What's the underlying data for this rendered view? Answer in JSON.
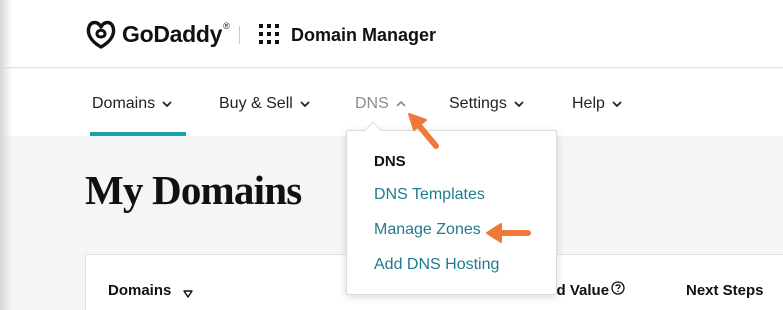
{
  "brand": {
    "logo_text": "GoDaddy",
    "trademark": "®",
    "app_title": "Domain Manager",
    "logo_icon": "godaddy-logo-icon",
    "apps_icon": "grid-apps-icon"
  },
  "nav": {
    "items": [
      {
        "label": "Domains",
        "state": "active"
      },
      {
        "label": "Buy & Sell",
        "state": "normal"
      },
      {
        "label": "DNS",
        "state": "open"
      },
      {
        "label": "Settings",
        "state": "normal"
      },
      {
        "label": "Help",
        "state": "normal"
      }
    ]
  },
  "dns_menu": {
    "header": "DNS",
    "items": [
      {
        "label": "DNS Templates"
      },
      {
        "label": "Manage Zones"
      },
      {
        "label": "Add DNS Hosting"
      }
    ]
  },
  "page": {
    "title": "My Domains"
  },
  "table": {
    "columns": [
      {
        "label": "Domains"
      },
      {
        "label": "Estimated Value"
      },
      {
        "label": "Next Steps"
      }
    ]
  },
  "colors": {
    "accent_teal": "#1aa3a3",
    "link_teal": "#1f7a8c",
    "annotation_arrow": "#f0793a",
    "muted_nav": "#8a8d90"
  }
}
